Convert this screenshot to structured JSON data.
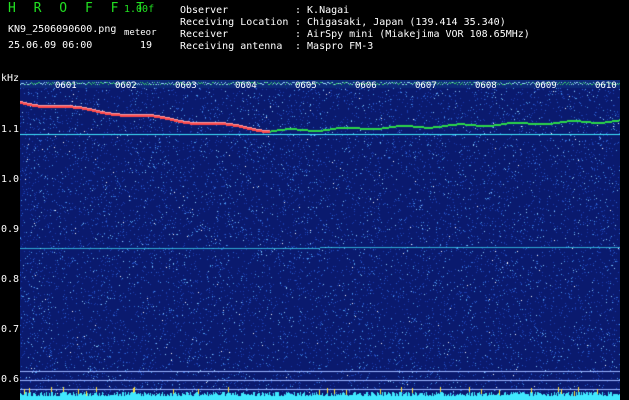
{
  "header": {
    "title": "H R O F F T",
    "version": "1.00f",
    "filename": "KN9_2506090600.png",
    "datetime": "25.06.09 06:00",
    "meteor_label": "meteor",
    "meteor_count": "19"
  },
  "info": [
    {
      "key": "Observer",
      "value": ": K.Nagai"
    },
    {
      "key": "Receiving Location",
      "value": ": Chigasaki, Japan (139.414 35.340)"
    },
    {
      "key": "Receiver",
      "value": ": AirSpy mini (Miakejima VOR 108.65MHz)"
    },
    {
      "key": "Receiving antenna",
      "value": ": Maspro FM-3"
    }
  ],
  "chart_data": {
    "type": "heatmap",
    "ylabel": "kHz",
    "yticks": [
      "1.1",
      "1.0",
      "0.9",
      "0.8",
      "0.7",
      "0.6"
    ],
    "ylim": [
      0.6,
      1.15
    ],
    "time_marks": [
      "0601",
      "0602",
      "0603",
      "0604",
      "0605",
      "0606",
      "0607",
      "0608",
      "0609",
      "0610"
    ],
    "colors": {
      "background": "#0a1a6e",
      "carrier": "#2cd84a",
      "meteor": "#ff4b4b",
      "baseline": "#40e8ff"
    }
  }
}
